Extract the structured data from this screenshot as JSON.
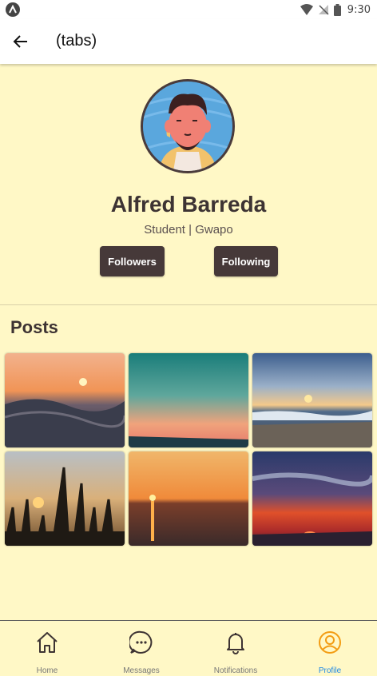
{
  "status_bar": {
    "time": "9:30"
  },
  "header": {
    "title": "(tabs)"
  },
  "profile": {
    "name": "Alfred Barreda",
    "bio": "Student | Gwapo",
    "followers_label": "Followers",
    "following_label": "Following"
  },
  "posts": {
    "title": "Posts",
    "items": [
      {
        "icon": "sunset-waves-photo"
      },
      {
        "icon": "teal-sky-sunset-photo"
      },
      {
        "icon": "beach-sunset-photo"
      },
      {
        "icon": "grass-silhouette-sunset-photo"
      },
      {
        "icon": "sea-sunset-photo"
      },
      {
        "icon": "red-horizon-sunset-photo"
      }
    ]
  },
  "bottom_nav": {
    "items": [
      {
        "label": "Home",
        "icon": "home-icon"
      },
      {
        "label": "Messages",
        "icon": "message-icon"
      },
      {
        "label": "Notifications",
        "icon": "bell-icon"
      },
      {
        "label": "Profile",
        "icon": "profile-icon",
        "active": true
      }
    ]
  },
  "colors": {
    "background": "#fff8c6",
    "button": "#463939",
    "active_tab": "#1e88e5"
  }
}
